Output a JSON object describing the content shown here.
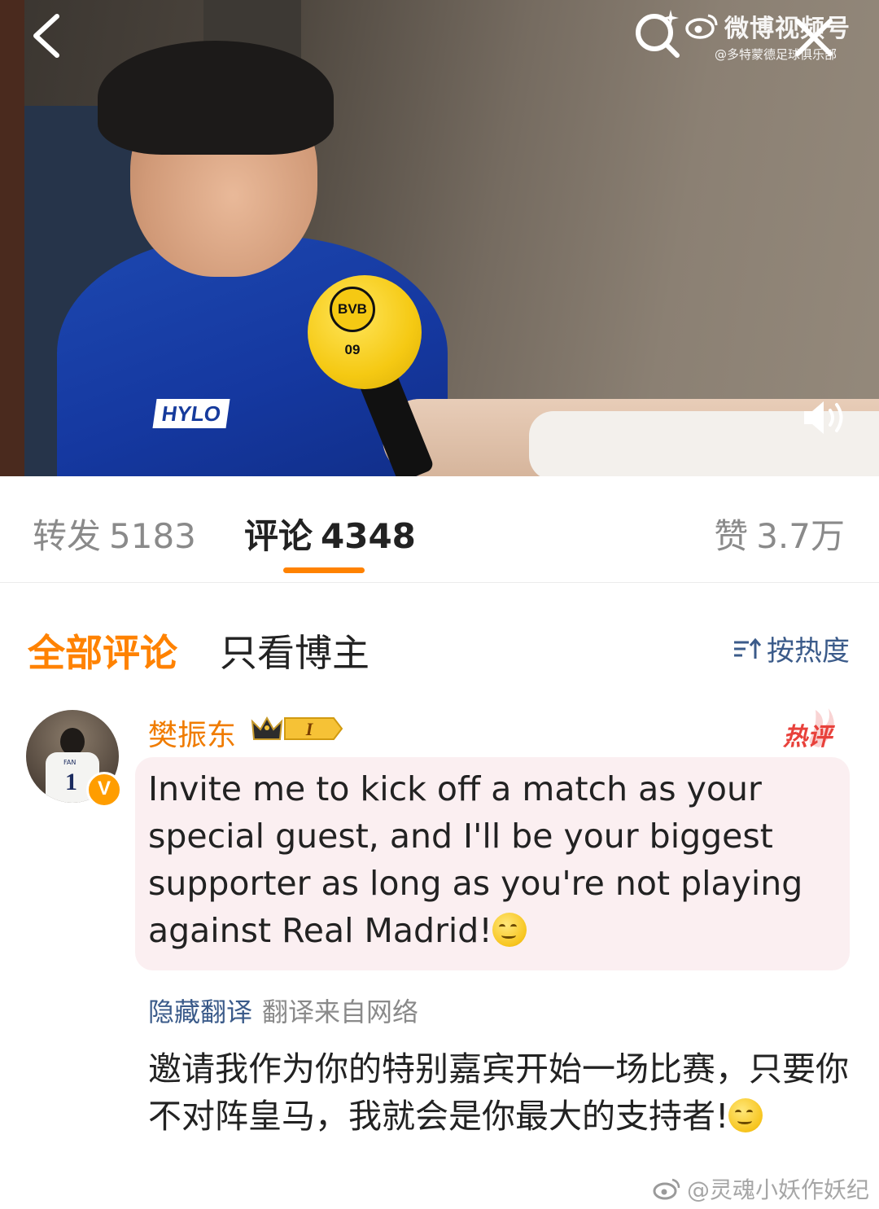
{
  "video": {
    "watermark_title": "微博视频号",
    "watermark_account": "@多特蒙德足球俱乐部",
    "mic_logo": "BVB 09",
    "shirt_brand": "HYLO"
  },
  "stats": {
    "reposts_label": "转发",
    "reposts_count": "5183",
    "comments_label": "评论",
    "comments_count": "4348",
    "likes_label": "赞",
    "likes_count": "3.7万",
    "active_tab": "comments",
    "accent_color": "#ff8200"
  },
  "filter": {
    "all_comments": "全部评论",
    "author_only": "只看博主",
    "sort_label": "按热度"
  },
  "comment": {
    "username": "樊振东",
    "vip_level": "I",
    "hot_tag": "热评",
    "avatar_jersey_number": "1",
    "avatar_jersey_name": "FAN",
    "verified_mark": "V",
    "text": "Invite me to kick off a match as your special guest, and I'll be your biggest supporter as long as you're not playing against Real Madrid!",
    "hide_translation": "隐藏翻译",
    "translation_source": "翻译来自网络",
    "translated_text": "邀请我作为你的特别嘉宾开始一场比赛，只要你不对阵皇马，我就会是你最大的支持者!"
  },
  "footer": {
    "watermark": "@灵魂小妖作妖纪"
  },
  "icons": {
    "back": "chevron-left-icon",
    "search": "search-icon",
    "close": "close-icon",
    "volume": "volume-icon",
    "sort": "sort-icon"
  }
}
